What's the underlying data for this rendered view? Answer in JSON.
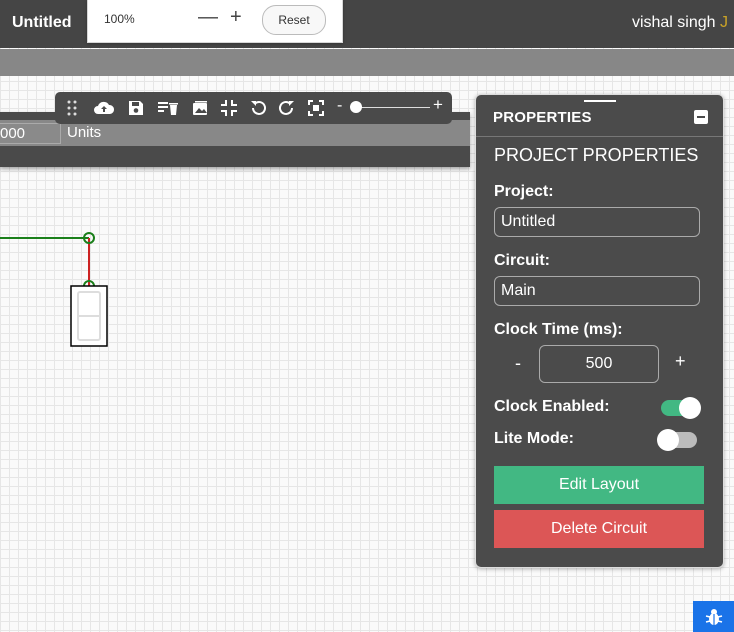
{
  "header": {
    "app_title": "Untitled",
    "user_name": "vishal singh",
    "user_name_cut": "J"
  },
  "zoom": {
    "level": "100%",
    "minus": "—",
    "plus": "+",
    "reset": "Reset"
  },
  "toolbar": {
    "tools": [
      "drag-handle-icon",
      "cloud-upload-icon",
      "save-icon",
      "delete-all-icon",
      "image-icon",
      "fit-icon",
      "undo-icon",
      "redo-icon",
      "fullscreen-icon"
    ],
    "slider_minus": "-",
    "slider_plus": "+",
    "slider_value": 0.0
  },
  "timing": {
    "value": "000",
    "units": "Units"
  },
  "properties": {
    "title": "PROPERTIES",
    "section": "PROJECT PROPERTIES",
    "project_label": "Project:",
    "project_value": "Untitled",
    "circuit_label": "Circuit:",
    "circuit_value": "Main",
    "clock_time_label": "Clock Time (ms):",
    "clock_minus": "-",
    "clock_plus": "+",
    "clock_value": "500",
    "clock_enabled_label": "Clock Enabled:",
    "clock_enabled": true,
    "lite_mode_label": "Lite Mode:",
    "lite_mode": false,
    "edit_layout": "Edit Layout",
    "delete_circuit": "Delete Circuit"
  },
  "colors": {
    "accent_green": "#42b883",
    "danger_red": "#dc5656",
    "panel": "#4b4b4b",
    "wire_green": "#1a7f1a",
    "wire_red": "#cc2222"
  }
}
